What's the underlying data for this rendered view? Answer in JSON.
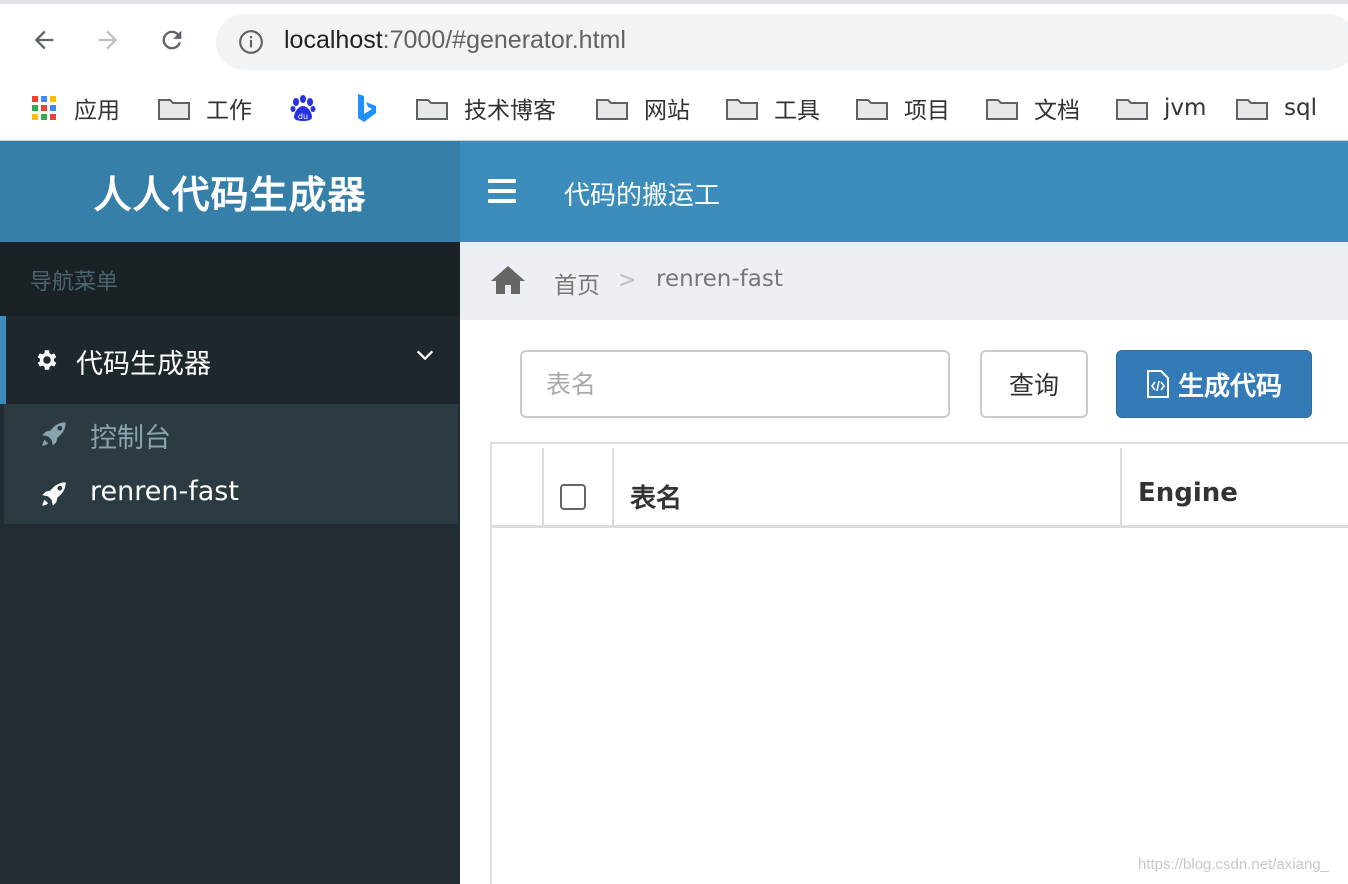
{
  "browser": {
    "url_host": "localhost",
    "url_rest": ":7000/#generator.html",
    "bookmarks": [
      {
        "label": "应用",
        "icon": "apps-grid-icon"
      },
      {
        "label": "工作",
        "icon": "folder-icon"
      },
      {
        "label": "",
        "icon": "baidu-icon"
      },
      {
        "label": "",
        "icon": "bing-icon"
      },
      {
        "label": "技术博客",
        "icon": "folder-icon"
      },
      {
        "label": "网站",
        "icon": "folder-icon"
      },
      {
        "label": "工具",
        "icon": "folder-icon"
      },
      {
        "label": "项目",
        "icon": "folder-icon"
      },
      {
        "label": "文档",
        "icon": "folder-icon"
      },
      {
        "label": "jvm",
        "icon": "folder-icon"
      },
      {
        "label": "sql",
        "icon": "folder-icon"
      }
    ]
  },
  "app": {
    "logo": "人人代码生成器",
    "header_title": "代码的搬运工",
    "accent": "#3c8dbc",
    "logo_bg": "#367fa9"
  },
  "sidebar": {
    "header": "导航菜单",
    "group": {
      "label": "代码生成器",
      "icon": "gear-icon"
    },
    "items": [
      {
        "label": "控制台",
        "icon": "rocket-icon"
      },
      {
        "label": "renren-fast",
        "icon": "rocket-icon"
      }
    ]
  },
  "breadcrumb": {
    "home_icon": "home-icon",
    "crumb1": "首页",
    "separator": ">",
    "crumb2": "renren-fast"
  },
  "toolbar": {
    "search_placeholder": "表名",
    "query_label": "查询",
    "generate_label": "生成代码"
  },
  "table": {
    "columns": [
      "表名",
      "Engine"
    ]
  },
  "watermark": "https://blog.csdn.net/axiang_"
}
